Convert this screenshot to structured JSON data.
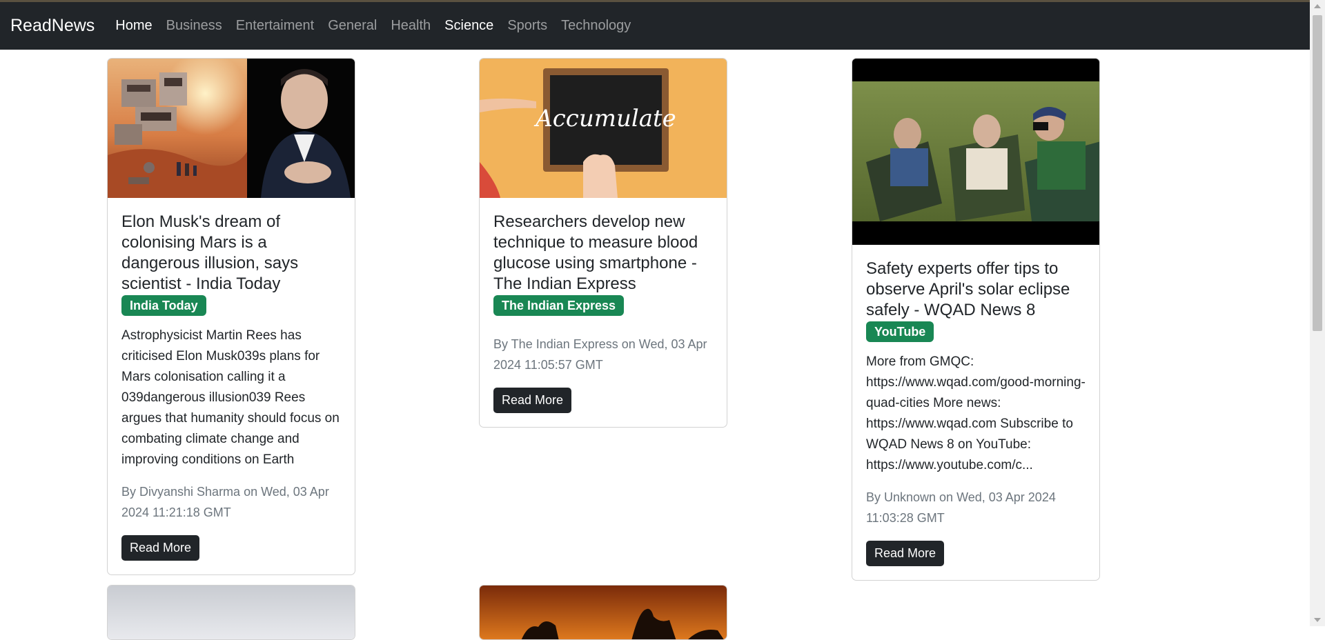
{
  "nav": {
    "brand": "ReadNews",
    "links": [
      {
        "label": "Home"
      },
      {
        "label": "Business"
      },
      {
        "label": "Entertaiment"
      },
      {
        "label": "General"
      },
      {
        "label": "Health"
      },
      {
        "label": "Science"
      },
      {
        "label": "Sports"
      },
      {
        "label": "Technology"
      }
    ],
    "active": "Home"
  },
  "cards": [
    {
      "title": "Elon Musk's dream of colonising Mars is a dangerous illusion, says scientist - India Today",
      "source": "India Today",
      "description": "Astrophysicist Martin Rees has criticised Elon Musk039s plans for Mars colonisation calling it a 039dangerous illusion039 Rees argues that humanity should focus on combating climate change and improving conditions on Earth",
      "meta": "By Divyanshi Sharma on Wed, 03 Apr 2024 11:21:18 GMT",
      "button": "Read More"
    },
    {
      "title": "Researchers develop new technique to measure blood glucose using smartphone - The Indian Express",
      "source": "The Indian Express",
      "image_text": "Accumulate",
      "meta": "By The Indian Express on Wed, 03 Apr 2024 11:05:57 GMT",
      "button": "Read More"
    },
    {
      "title": "Safety experts offer tips to observe April's solar eclipse safely - WQAD News 8",
      "source": "YouTube",
      "description": "More from GMQC: https://www.wqad.com/good-morning-quad-cities More news: https://www.wqad.com Subscribe to WQAD News 8 on YouTube: https://www.youtube.com/c...",
      "meta": "By Unknown on Wed, 03 Apr 2024 11:03:28 GMT",
      "button": "Read More"
    }
  ],
  "colors": {
    "navbar": "#212529",
    "badge": "#198754",
    "button": "#212529",
    "meta": "#6c757d"
  }
}
